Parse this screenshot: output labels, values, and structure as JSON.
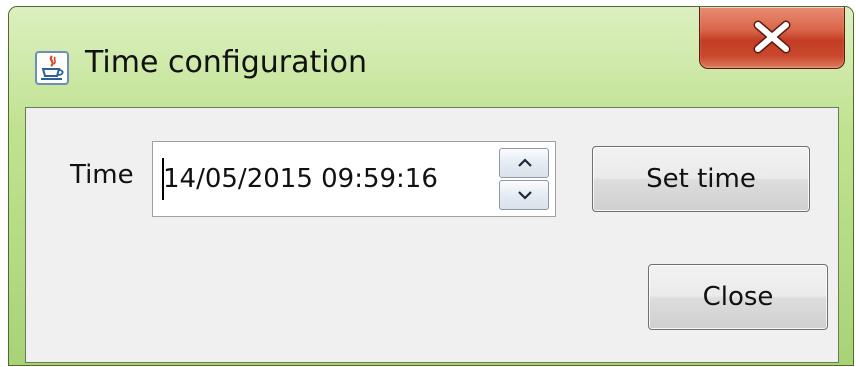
{
  "window": {
    "title": "Time configuration",
    "icon": "java-cup-icon",
    "close_icon": "close-icon",
    "frame_color": "#b8dd8a",
    "close_button_color": "#c94a30"
  },
  "form": {
    "time_label": "Time",
    "time_value": "14/05/2015 09:59:16",
    "spinner_up_icon": "chevron-up-icon",
    "spinner_down_icon": "chevron-down-icon",
    "set_time_button": "Set time",
    "close_button": "Close"
  }
}
